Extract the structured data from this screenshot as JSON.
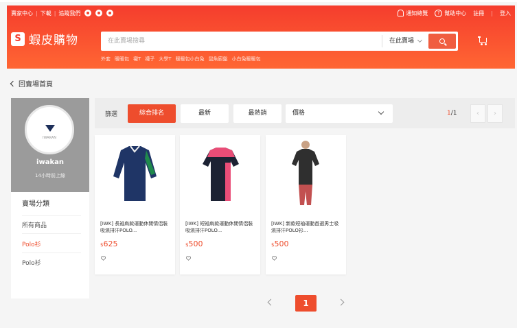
{
  "topbar": {
    "seller_centre": "賣家中心",
    "download": "下載",
    "follow_us": "追蹤我們",
    "notifications": "通知總覽",
    "help_centre": "幫助中心",
    "signup": "註冊",
    "login": "登入"
  },
  "brand": {
    "logo_text": "蝦皮購物",
    "bag_letter": "S"
  },
  "search": {
    "placeholder": "在此賣場搜尋",
    "scope": "在此賣場",
    "hotwords": [
      "外套",
      "暖暖包",
      "襯T",
      "襪子",
      "大學T",
      "暖暖包小白兔",
      "鼠魚廚盤",
      "小白兔暖暖包"
    ]
  },
  "nav": {
    "back_label": "回賣場首頁"
  },
  "shop": {
    "brand_mark": "IWAKAN",
    "name": "iwakan",
    "online_status": "14小時前上線"
  },
  "categories": {
    "title": "賣場分類",
    "items": [
      {
        "label": "所有商品",
        "active": false
      },
      {
        "label": "Polo衫",
        "active": true
      },
      {
        "label": "Polo衫",
        "active": false
      }
    ]
  },
  "sort": {
    "label": "篩選",
    "options": [
      "綜合排名",
      "最新",
      "最熱銷"
    ],
    "active": "綜合排名",
    "price_label": "價格",
    "page_current": "1",
    "page_total": "/1",
    "prev": "‹",
    "next": "›"
  },
  "products": [
    {
      "name": "[IWK] 長袖肩款運動休閒情侶裝吸濕排汗POLO...",
      "price": "625",
      "currency": "$",
      "shirt_color": "#1f3566",
      "accent": "#1f8a4c"
    },
    {
      "name": "[IWK] 短袖肩款運動休閒情侶裝吸濕排汗POLO...",
      "price": "500",
      "currency": "$",
      "shirt_color": "#1c2233",
      "accent": "#e94d77"
    },
    {
      "name": "[IWK] 新款短袖運動首選男士吸濕排汗POLO衫...",
      "price": "500",
      "currency": "$",
      "shirt_color": "#2f2f2f",
      "accent": "#c44"
    }
  ],
  "pagination": {
    "current": "1"
  },
  "colors": {
    "brand": "#ee4d2d",
    "header_start": "#f53d2d",
    "header_end": "#ff6633"
  }
}
